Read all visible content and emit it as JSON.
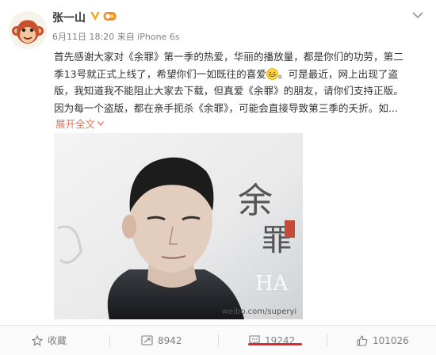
{
  "post": {
    "author": "张一山",
    "meta": "6月11日 18:20 来自 iPhone 6s",
    "lines": [
      "首先感谢大家对《余罪》第一季的热爱，华丽的播放量，都是你们的功劳，第二",
      "季13号就正式上线了，希望你们一如既往的喜爱",
      "。可是最近，网上出现了盗",
      "版，我知道我不能阻止大家去下载，但真爱《余罪》的朋友，请你们支持正版。",
      "因为每一个盗版，都在亲手扼杀《余罪》，可能会直接导致第三季的夭折。如..."
    ],
    "expand_label": "展开全文",
    "photo": {
      "calligraphy_a": "余",
      "calligraphy_b": "罪",
      "side_text": "HA",
      "watermark": "weibo.com/superyi",
      "seal_text": "余罪"
    }
  },
  "footer": {
    "favorite_label": "收藏",
    "repost_count": "8942",
    "comment_count": "19242",
    "like_count": "101026"
  },
  "colors": {
    "accent_orange": "#eb7350",
    "meta_gray": "#808080",
    "underline_red": "#e12a2a",
    "verified_gold": "#f5a623"
  },
  "icons": [
    "monkey-avatar-icon",
    "verified-icon",
    "medal-icon",
    "chevron-down-icon",
    "grin-emoji-icon",
    "star-icon",
    "repost-icon",
    "comment-icon",
    "thumbs-up-icon"
  ]
}
